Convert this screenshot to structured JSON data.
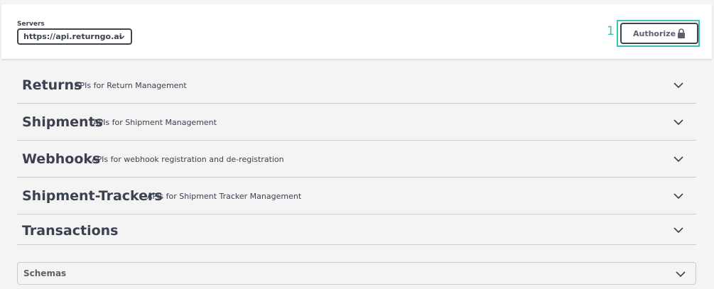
{
  "servers": {
    "label": "Servers",
    "selected": "https://api.returngo.ai"
  },
  "authorize": {
    "step_number": "1",
    "label": "Authorize",
    "highlight_color": "#3cc0b3"
  },
  "tags": [
    {
      "name": "Returns",
      "description": "APIs for Return Management"
    },
    {
      "name": "Shipments",
      "description": "APIs for Shipment Management"
    },
    {
      "name": "Webhooks",
      "description": "APIs for webhook registration and de-registration"
    },
    {
      "name": "Shipment-Trackers",
      "description": "APIs for Shipment Tracker Management"
    },
    {
      "name": "Transactions",
      "description": ""
    }
  ],
  "schemas": {
    "title": "Schemas"
  },
  "icons": {
    "select": "chevron-down-icon",
    "authorize": "lock-icon",
    "expand": "chevron-down-icon"
  },
  "colors": {
    "text": "#3b4151",
    "accent": "#3cc0b3",
    "background": "#f4f4f4"
  }
}
